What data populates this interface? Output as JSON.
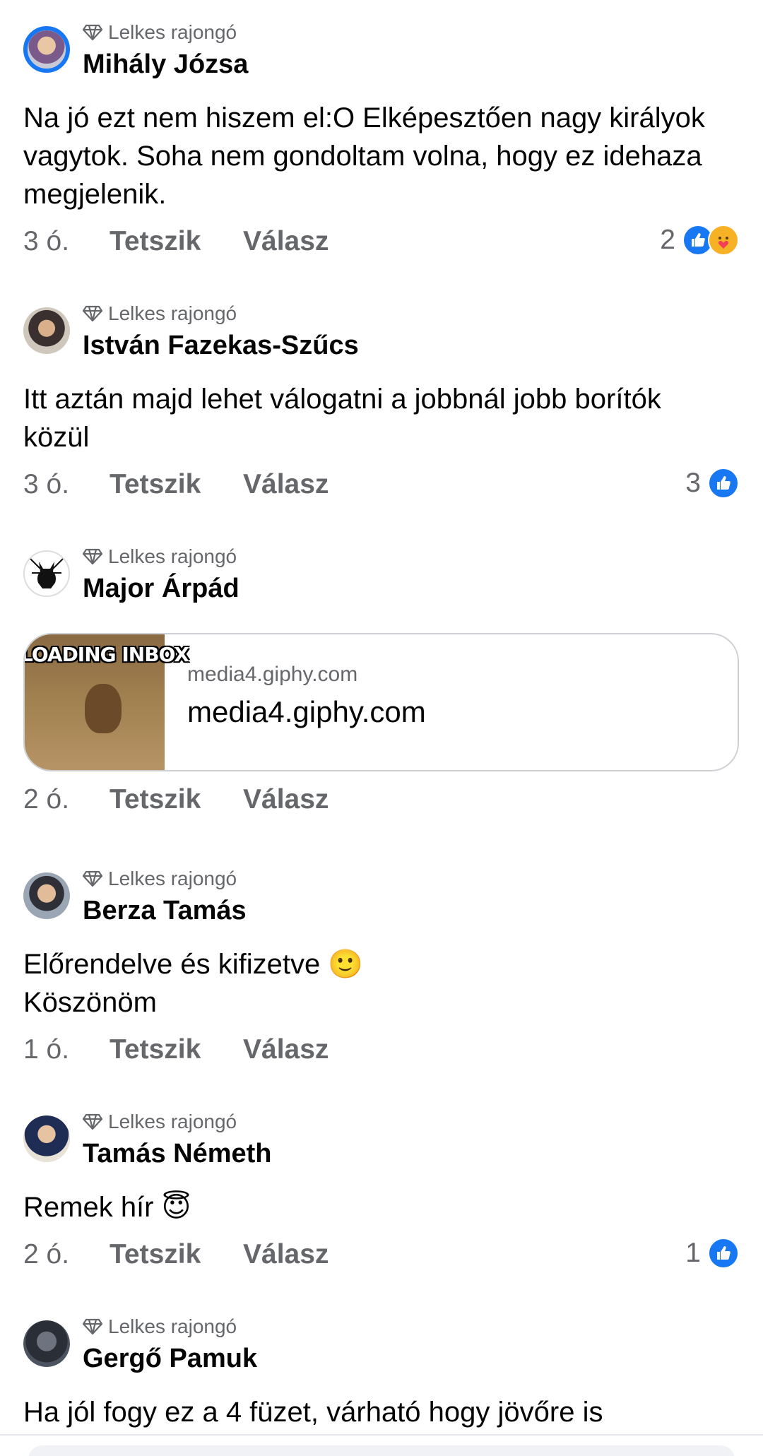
{
  "comments": [
    {
      "badge": "Lelkes rajongó",
      "name": "Mihály Józsa",
      "lines": [
        "Na jó ezt nem hiszem el:O Elképesztően nagy királyok",
        "vagytok. Soha nem gondoltam volna, hogy ez idehaza",
        "megjelenik."
      ],
      "time": "3 ó.",
      "like": "Tetszik",
      "reply": "Válasz",
      "reaction_count": "2",
      "reactions": [
        "like-reaction-icon",
        "care-reaction-icon"
      ]
    },
    {
      "badge": "Lelkes rajongó",
      "name": "István Fazekas-Szűcs",
      "lines": [
        "Itt aztán majd lehet válogatni a jobbnál jobb borítók",
        "közül"
      ],
      "time": "3 ó.",
      "like": "Tetszik",
      "reply": "Válasz",
      "reaction_count": "3",
      "reactions": [
        "like-reaction-icon"
      ]
    },
    {
      "badge": "Lelkes rajongó",
      "name": "Major Árpád",
      "link": {
        "thumb_caption": "LOADING INBOX",
        "domain": "media4.giphy.com",
        "title": "media4.giphy.com"
      },
      "time": "2 ó.",
      "like": "Tetszik",
      "reply": "Válasz"
    },
    {
      "badge": "Lelkes rajongó",
      "name": "Berza Tamás",
      "lines": [
        "Előrendelve és kifizetve 🙂",
        "Köszönöm"
      ],
      "time": "1 ó.",
      "like": "Tetszik",
      "reply": "Válasz"
    },
    {
      "badge": "Lelkes rajongó",
      "name": "Tamás Németh",
      "lines": [
        "Remek hír 😇"
      ],
      "time": "2 ó.",
      "like": "Tetszik",
      "reply": "Válasz",
      "reaction_count": "1",
      "reactions": [
        "like-reaction-icon"
      ]
    },
    {
      "badge": "Lelkes rajongó",
      "name": "Gergő Pamuk",
      "lines": [
        "Ha jól fogy ez a 4 füzet, várható hogy jövőre is"
      ]
    }
  ],
  "colors": {
    "accent": "#1877f2",
    "secondary_text": "#65676b",
    "primary_text": "#050505",
    "care_reaction": "#f7b125"
  }
}
